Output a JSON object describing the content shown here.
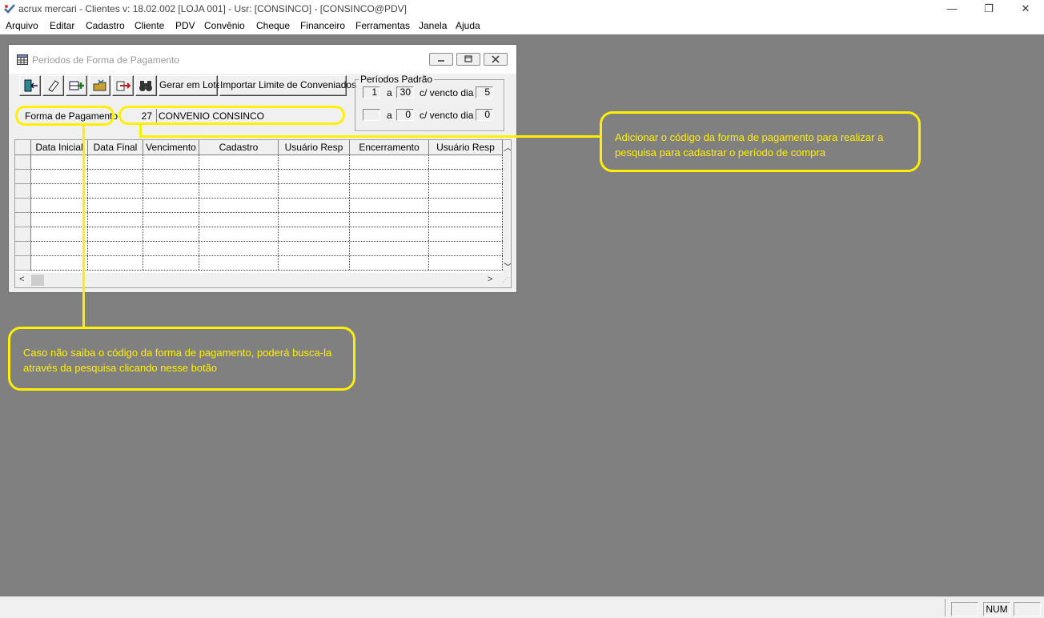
{
  "window": {
    "title": "acrux mercari - Clientes  v: 18.02.002  [LOJA 001] - Usr: [CONSINCO] - [CONSINCO@PDV]",
    "min_glyph": "—",
    "max_glyph": "❐",
    "close_glyph": "✕"
  },
  "menubar": {
    "items": [
      "Arquivo",
      "Editar",
      "Cadastro",
      "Cliente",
      "PDV",
      "Convênio",
      "Cheque",
      "Financeiro",
      "Ferramentas",
      "Janela",
      "Ajuda"
    ]
  },
  "child_window": {
    "title": "Períodos de Forma de Pagamento"
  },
  "toolbar": {
    "icons": [
      "exit-icon",
      "eraser-icon",
      "add-icon",
      "folder-open-icon",
      "export-icon",
      "binoculars-icon"
    ],
    "gerar_em_lote": "Gerar em Lote",
    "importar_limite": "Importar Limite de Conveniados"
  },
  "periodos_padrao": {
    "legend": "Períodos Padrão",
    "row1": {
      "from": "1",
      "sep": "a",
      "to": "30",
      "label": "c/ vencto dia",
      "dia": "5"
    },
    "row2": {
      "from": "",
      "sep": "a",
      "to": "0",
      "label": "c/ vencto dia",
      "dia": "0"
    }
  },
  "forma_pagamento": {
    "label": "Forma de Pagamento",
    "code": "27",
    "description": "CONVENIO CONSINCO"
  },
  "grid": {
    "columns": [
      "Data Inicial",
      "Data Final",
      "Vencimento",
      "Cadastro",
      "Usuário Resp",
      "Encerramento",
      "Usuário Resp"
    ],
    "rows": 8
  },
  "statusbar": {
    "num": "NUM"
  },
  "annotations": {
    "callout_code": "Adicionar o código da forma de pagamento para realizar a pesquisa para cadastrar o período de compra",
    "callout_button": "Caso não saiba o código da forma de pagamento, poderá busca-la através da pesquisa clicando nesse botão"
  },
  "colors": {
    "highlight": "#ffef00",
    "desktop": "#808080"
  }
}
